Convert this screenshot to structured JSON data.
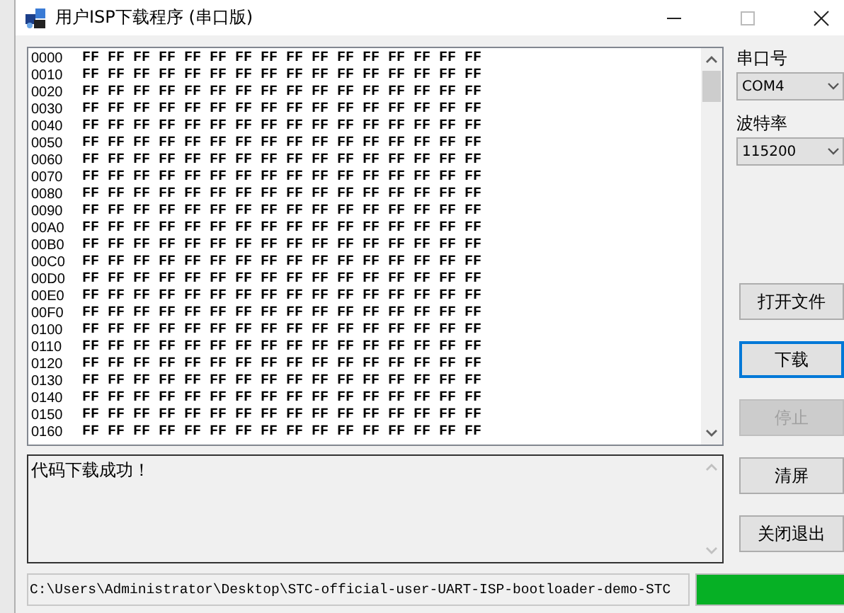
{
  "window": {
    "title": "用户ISP下载程序 (串口版)"
  },
  "hex_view": {
    "rows": [
      {
        "address": "0000",
        "bytes": "FF FF FF FF FF FF FF FF FF FF FF FF FF FF FF FF"
      },
      {
        "address": "0010",
        "bytes": "FF FF FF FF FF FF FF FF FF FF FF FF FF FF FF FF"
      },
      {
        "address": "0020",
        "bytes": "FF FF FF FF FF FF FF FF FF FF FF FF FF FF FF FF"
      },
      {
        "address": "0030",
        "bytes": "FF FF FF FF FF FF FF FF FF FF FF FF FF FF FF FF"
      },
      {
        "address": "0040",
        "bytes": "FF FF FF FF FF FF FF FF FF FF FF FF FF FF FF FF"
      },
      {
        "address": "0050",
        "bytes": "FF FF FF FF FF FF FF FF FF FF FF FF FF FF FF FF"
      },
      {
        "address": "0060",
        "bytes": "FF FF FF FF FF FF FF FF FF FF FF FF FF FF FF FF"
      },
      {
        "address": "0070",
        "bytes": "FF FF FF FF FF FF FF FF FF FF FF FF FF FF FF FF"
      },
      {
        "address": "0080",
        "bytes": "FF FF FF FF FF FF FF FF FF FF FF FF FF FF FF FF"
      },
      {
        "address": "0090",
        "bytes": "FF FF FF FF FF FF FF FF FF FF FF FF FF FF FF FF"
      },
      {
        "address": "00A0",
        "bytes": "FF FF FF FF FF FF FF FF FF FF FF FF FF FF FF FF"
      },
      {
        "address": "00B0",
        "bytes": "FF FF FF FF FF FF FF FF FF FF FF FF FF FF FF FF"
      },
      {
        "address": "00C0",
        "bytes": "FF FF FF FF FF FF FF FF FF FF FF FF FF FF FF FF"
      },
      {
        "address": "00D0",
        "bytes": "FF FF FF FF FF FF FF FF FF FF FF FF FF FF FF FF"
      },
      {
        "address": "00E0",
        "bytes": "FF FF FF FF FF FF FF FF FF FF FF FF FF FF FF FF"
      },
      {
        "address": "00F0",
        "bytes": "FF FF FF FF FF FF FF FF FF FF FF FF FF FF FF FF"
      },
      {
        "address": "0100",
        "bytes": "FF FF FF FF FF FF FF FF FF FF FF FF FF FF FF FF"
      },
      {
        "address": "0110",
        "bytes": "FF FF FF FF FF FF FF FF FF FF FF FF FF FF FF FF"
      },
      {
        "address": "0120",
        "bytes": "FF FF FF FF FF FF FF FF FF FF FF FF FF FF FF FF"
      },
      {
        "address": "0130",
        "bytes": "FF FF FF FF FF FF FF FF FF FF FF FF FF FF FF FF"
      },
      {
        "address": "0140",
        "bytes": "FF FF FF FF FF FF FF FF FF FF FF FF FF FF FF FF"
      },
      {
        "address": "0150",
        "bytes": "FF FF FF FF FF FF FF FF FF FF FF FF FF FF FF FF"
      },
      {
        "address": "0160",
        "bytes": "FF FF FF FF FF FF FF FF FF FF FF FF FF FF FF FF"
      }
    ]
  },
  "log": {
    "text": "代码下载成功！"
  },
  "port": {
    "label": "串口号",
    "value": "COM4"
  },
  "baud": {
    "label": "波特率",
    "value": "115200"
  },
  "buttons": [
    {
      "label": "打开文件",
      "focused": false,
      "disabled": false
    },
    {
      "label": "下载",
      "focused": true,
      "disabled": false
    },
    {
      "label": "停止",
      "focused": false,
      "disabled": true
    },
    {
      "label": "清屏",
      "focused": false,
      "disabled": false
    },
    {
      "label": "关闭退出",
      "focused": false,
      "disabled": false
    }
  ],
  "path_field": {
    "value": "C:\\Users\\Administrator\\Desktop\\STC-official-user-UART-ISP-bootloader-demo-STC"
  },
  "progress": {
    "level": 1
  }
}
